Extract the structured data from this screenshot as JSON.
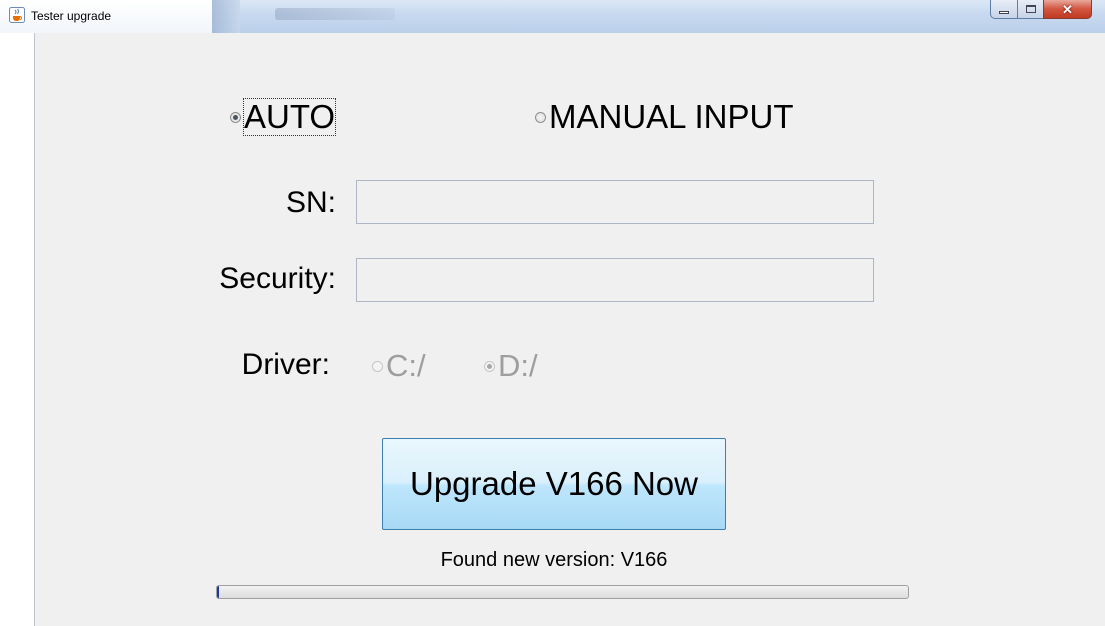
{
  "window": {
    "title": "Tester upgrade",
    "icons": {
      "app": "java-cup-icon",
      "minimize": "minimize-icon",
      "maximize": "maximize-icon",
      "close": "close-icon"
    }
  },
  "mode": {
    "auto_label": "AUTO",
    "manual_label": "MANUAL INPUT",
    "selected": "AUTO"
  },
  "form": {
    "sn_label": "SN:",
    "sn_value": "",
    "security_label": "Security:",
    "security_value": "",
    "driver_label": "Driver:",
    "driver_c_label": "C:/",
    "driver_d_label": "D:/",
    "driver_selected": "D:/"
  },
  "action": {
    "upgrade_label": "Upgrade V166 Now"
  },
  "status": {
    "message": "Found new version: V166",
    "progress_fraction": 0.003
  },
  "colors": {
    "button_gradient_top": "#eaf6fd",
    "button_gradient_bottom": "#a7d9f5",
    "button_border": "#3c7fb1",
    "progress_fill": "#1e3a9e",
    "disabled_text": "#9e9e9e"
  }
}
